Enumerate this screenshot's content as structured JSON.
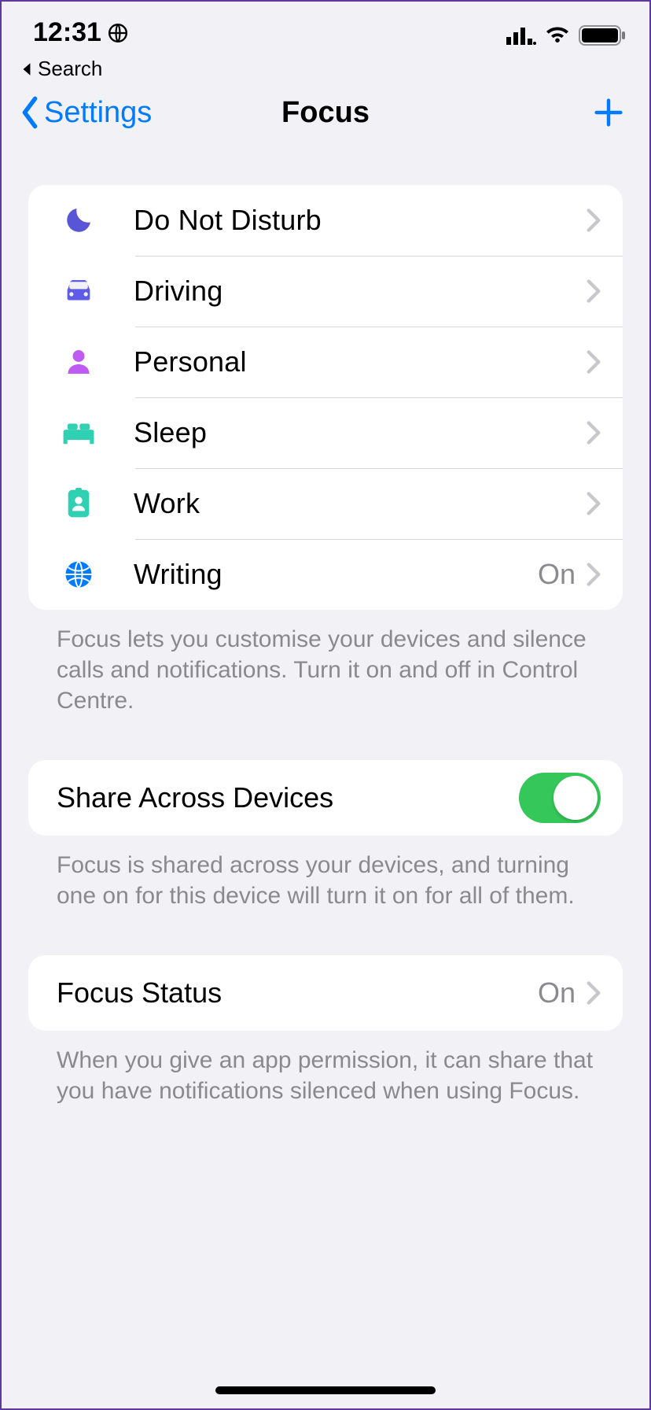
{
  "status": {
    "time": "12:31",
    "breadcrumb": "Search"
  },
  "nav": {
    "back_label": "Settings",
    "title": "Focus"
  },
  "focus_modes": [
    {
      "key": "dnd",
      "label": "Do Not Disturb",
      "value": "",
      "icon_color": "#5856d6"
    },
    {
      "key": "driving",
      "label": "Driving",
      "value": "",
      "icon_color": "#5856d6"
    },
    {
      "key": "personal",
      "label": "Personal",
      "value": "",
      "icon_color": "#af52de"
    },
    {
      "key": "sleep",
      "label": "Sleep",
      "value": "",
      "icon_color": "#30d1b3"
    },
    {
      "key": "work",
      "label": "Work",
      "value": "",
      "icon_color": "#30d1b3"
    },
    {
      "key": "writing",
      "label": "Writing",
      "value": "On",
      "icon_color": "#007aff"
    }
  ],
  "focus_footer": "Focus lets you customise your devices and silence calls and notifications. Turn it on and off in Control Centre.",
  "share": {
    "label": "Share Across Devices",
    "on": true,
    "footer": "Focus is shared across your devices, and turning one on for this device will turn it on for all of them."
  },
  "focus_status": {
    "label": "Focus Status",
    "value": "On",
    "footer": "When you give an app permission, it can share that you have notifications silenced when using Focus."
  }
}
